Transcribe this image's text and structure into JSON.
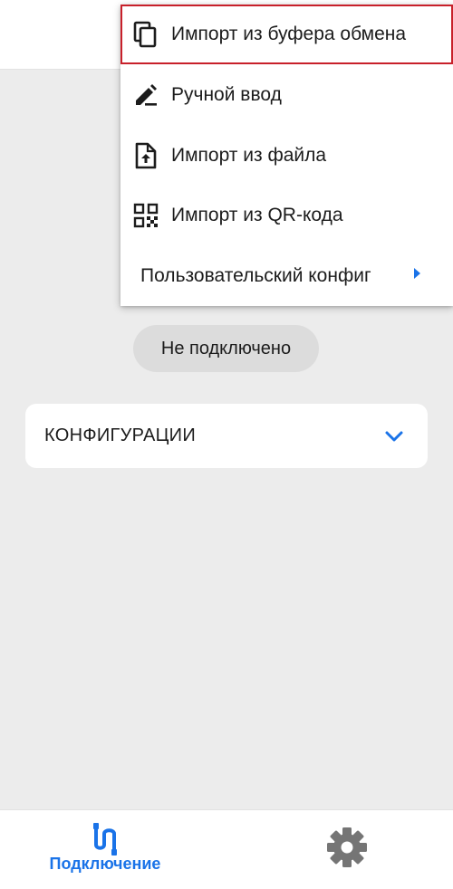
{
  "menu": {
    "items": [
      {
        "label": "Импорт из буфера обмена",
        "icon": "clipboard-copy-icon"
      },
      {
        "label": "Ручной ввод",
        "icon": "pencil-icon"
      },
      {
        "label": "Импорт из файла",
        "icon": "file-upload-icon"
      },
      {
        "label": "Импорт из QR-кода",
        "icon": "qr-code-icon"
      },
      {
        "label": "Пользовательский конфиг",
        "icon": "submenu-arrow-icon"
      }
    ]
  },
  "status": {
    "text": "Не подключено"
  },
  "configs": {
    "title": "КОНФИГУРАЦИИ",
    "icon": "chevron-down-icon"
  },
  "bottom_nav": {
    "connect_label": "Подключение",
    "connect_icon": "connection-icon",
    "settings_icon": "gear-icon"
  },
  "colors": {
    "accent": "#1a73e8",
    "highlight_border": "#c8202a",
    "background": "#ececec",
    "badge": "#dcdcdc"
  }
}
